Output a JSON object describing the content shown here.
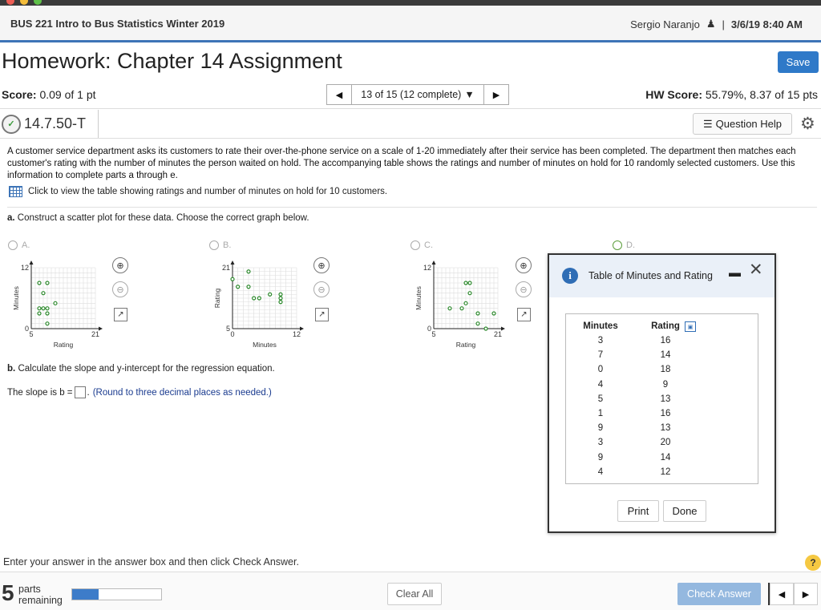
{
  "course": {
    "title": "BUS 221 Intro to Bus Statistics Winter 2019",
    "user": "Sergio Naranjo",
    "datetime": "3/6/19 8:40 AM"
  },
  "homework": {
    "title": "Homework: Chapter 14 Assignment",
    "save_label": "Save"
  },
  "score": {
    "label": "Score:",
    "value": "0.09 of 1 pt"
  },
  "pager": {
    "text": "13 of 15 (12 complete)"
  },
  "hw_score": {
    "label": "HW Score:",
    "value": "55.79%, 8.37 of 15 pts"
  },
  "question": {
    "id": "14.7.50-T",
    "help_label": "Question Help"
  },
  "problem": {
    "text": "A customer service department asks its customers to rate their over-the-phone service on a scale of 1-20 immediately after their service has been completed. The department then matches each customer's rating with the number of minutes the person waited on hold. The accompanying table shows the ratings and number of minutes on hold for 10 randomly selected customers. Use this information to complete parts a through e.",
    "table_link": "Click to view the table showing ratings and number of minutes on hold for 10 customers.",
    "part_a_label": "a.",
    "part_a_text": "Construct a scatter plot for these data. Choose the correct graph below.",
    "part_b_label": "b.",
    "part_b_text": "Calculate the slope and y-intercept for the regression equation.",
    "slope_pre": "The slope is b =",
    "slope_post": ".",
    "slope_hint": "(Round to three decimal places as needed.)"
  },
  "options": [
    {
      "label": "A."
    },
    {
      "label": "B."
    },
    {
      "label": "C."
    },
    {
      "label": "D."
    }
  ],
  "chart_data": [
    {
      "type": "scatter",
      "xlabel": "Rating",
      "ylabel": "Minutes",
      "xlim": [
        5,
        21
      ],
      "ylim": [
        0,
        12
      ],
      "xticks": [
        "5",
        "21"
      ],
      "yticks": [
        "0",
        "12"
      ],
      "x": [
        7,
        8,
        9,
        11,
        7,
        8,
        7,
        9,
        9,
        9
      ],
      "y": [
        9,
        7,
        9,
        5,
        4,
        4,
        3,
        3,
        4,
        1
      ]
    },
    {
      "type": "scatter",
      "xlabel": "Minutes",
      "ylabel": "Rating",
      "xlim": [
        0,
        12
      ],
      "ylim": [
        5,
        21
      ],
      "xticks": [
        "0",
        "12"
      ],
      "yticks": [
        "5",
        "21"
      ],
      "x": [
        0,
        1,
        3,
        3,
        4,
        5,
        7,
        9,
        9,
        9
      ],
      "y": [
        18,
        16,
        16,
        20,
        13,
        13,
        14,
        13,
        14,
        12
      ]
    },
    {
      "type": "scatter",
      "xlabel": "Rating",
      "ylabel": "Minutes",
      "xlim": [
        5,
        21
      ],
      "ylim": [
        0,
        12
      ],
      "xticks": [
        "5",
        "21"
      ],
      "yticks": [
        "0",
        "12"
      ],
      "x": [
        16,
        14,
        18,
        9,
        13,
        16,
        13,
        20,
        14,
        12
      ],
      "y": [
        3,
        7,
        0,
        4,
        5,
        1,
        9,
        3,
        9,
        4
      ]
    }
  ],
  "modal": {
    "title": "Table of Minutes and Rating",
    "headers": [
      "Minutes",
      "Rating"
    ],
    "rows": [
      [
        "3",
        "16"
      ],
      [
        "7",
        "14"
      ],
      [
        "0",
        "18"
      ],
      [
        "4",
        "9"
      ],
      [
        "5",
        "13"
      ],
      [
        "1",
        "16"
      ],
      [
        "9",
        "13"
      ],
      [
        "3",
        "20"
      ],
      [
        "9",
        "14"
      ],
      [
        "4",
        "12"
      ]
    ],
    "print_label": "Print",
    "done_label": "Done"
  },
  "footer": {
    "message": "Enter your answer in the answer box and then click Check Answer.",
    "parts_count": "5",
    "parts_label_1": "parts",
    "parts_label_2": "remaining",
    "progress": 0.3,
    "clear_label": "Clear All",
    "check_label": "Check Answer"
  }
}
